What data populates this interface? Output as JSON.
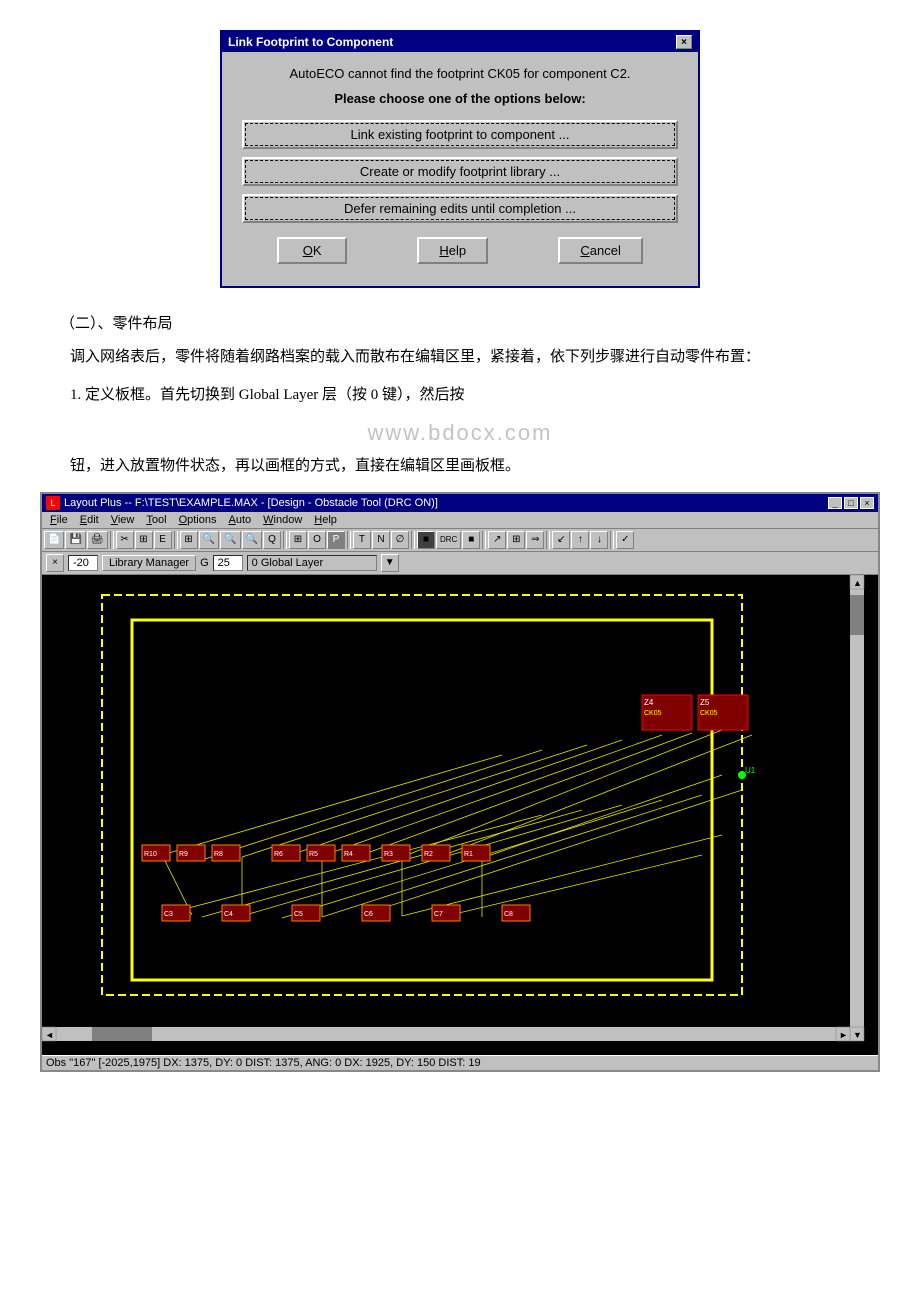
{
  "dialog": {
    "title": "Link Footprint to Component",
    "close_btn": "×",
    "message1": "AutoECO cannot find the footprint CK05 for component C2.",
    "message2": "Please choose one of the options below:",
    "option1": "Link existing footprint to component ...",
    "option2": "Create or modify footprint library ...",
    "option3": "Defer remaining edits until completion ...",
    "btn_ok": "OK",
    "btn_help": "Help",
    "btn_cancel": "Cancel"
  },
  "section": {
    "title": "（二）、零件布局",
    "paragraph1": "调入网络表后，零件将随着纲路档案的载入而散布在编辑区里，紧接着，依下列步骤进行自动零件布置：",
    "step1": "1.  定义板框。首先切换到 Global Layer 层（按 0 键），然后按",
    "step2": "钮，进入放置物件状态，再以画框的方式，直接在编辑区里画板框。"
  },
  "watermark": "www.bdocx.com",
  "pcb": {
    "title": "Layout Plus -- F:\\TEST\\EXAMPLE.MAX - [Design - Obstacle Tool (DRC ON)]",
    "menu_items": [
      "File",
      "Edit",
      "View",
      "Tool",
      "Options",
      "Auto",
      "Window",
      "Help"
    ],
    "toolbar_items": [
      "📄",
      "💾",
      "🖨",
      "×",
      "🔧",
      "E",
      "⊞",
      "🔍",
      "🔍",
      "🔍",
      "Q",
      "⊞",
      "O",
      "P",
      "T",
      "N",
      "∅",
      "■",
      "DRC",
      "■",
      "↗",
      "⊞",
      "⇒",
      "↙",
      "↑",
      "↓",
      "✓"
    ],
    "second_bar": {
      "x_coord": "-20",
      "lib_btn": "Library Manager",
      "g_label": "G",
      "g_value": "25",
      "layer_label": "0 Global Layer"
    },
    "statusbar": "Obs \"167\" [-2025,1975]  DX: 1375, DY: 0  DIST: 1375, ANG: 0    DX: 1925, DY: 150 DIST: 19"
  }
}
